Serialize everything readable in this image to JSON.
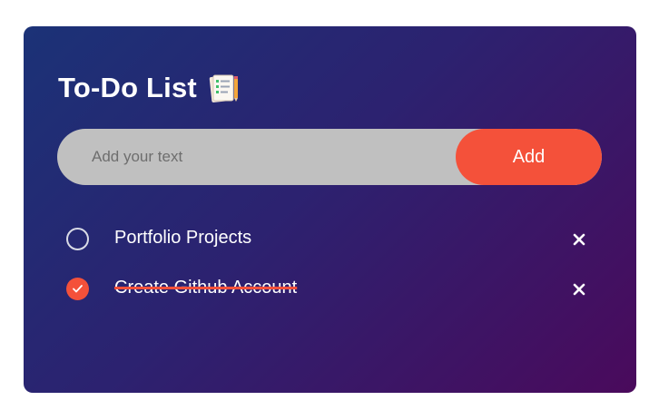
{
  "app": {
    "title": "To-Do List",
    "title_icon": "notepad-pencil-icon"
  },
  "input": {
    "placeholder": "Add your text",
    "value": ""
  },
  "buttons": {
    "add_label": "Add"
  },
  "colors": {
    "accent": "#f4513a",
    "gradient_start": "#1b3277",
    "gradient_end": "#4a0a5c",
    "input_bg": "#c0c0c0"
  },
  "tasks": [
    {
      "label": "Portfolio Projects",
      "completed": false,
      "check_icon": "empty-circle-icon",
      "delete_icon": "close-icon"
    },
    {
      "label": "Create Github Account",
      "completed": true,
      "check_icon": "checked-circle-icon",
      "delete_icon": "close-icon"
    }
  ]
}
